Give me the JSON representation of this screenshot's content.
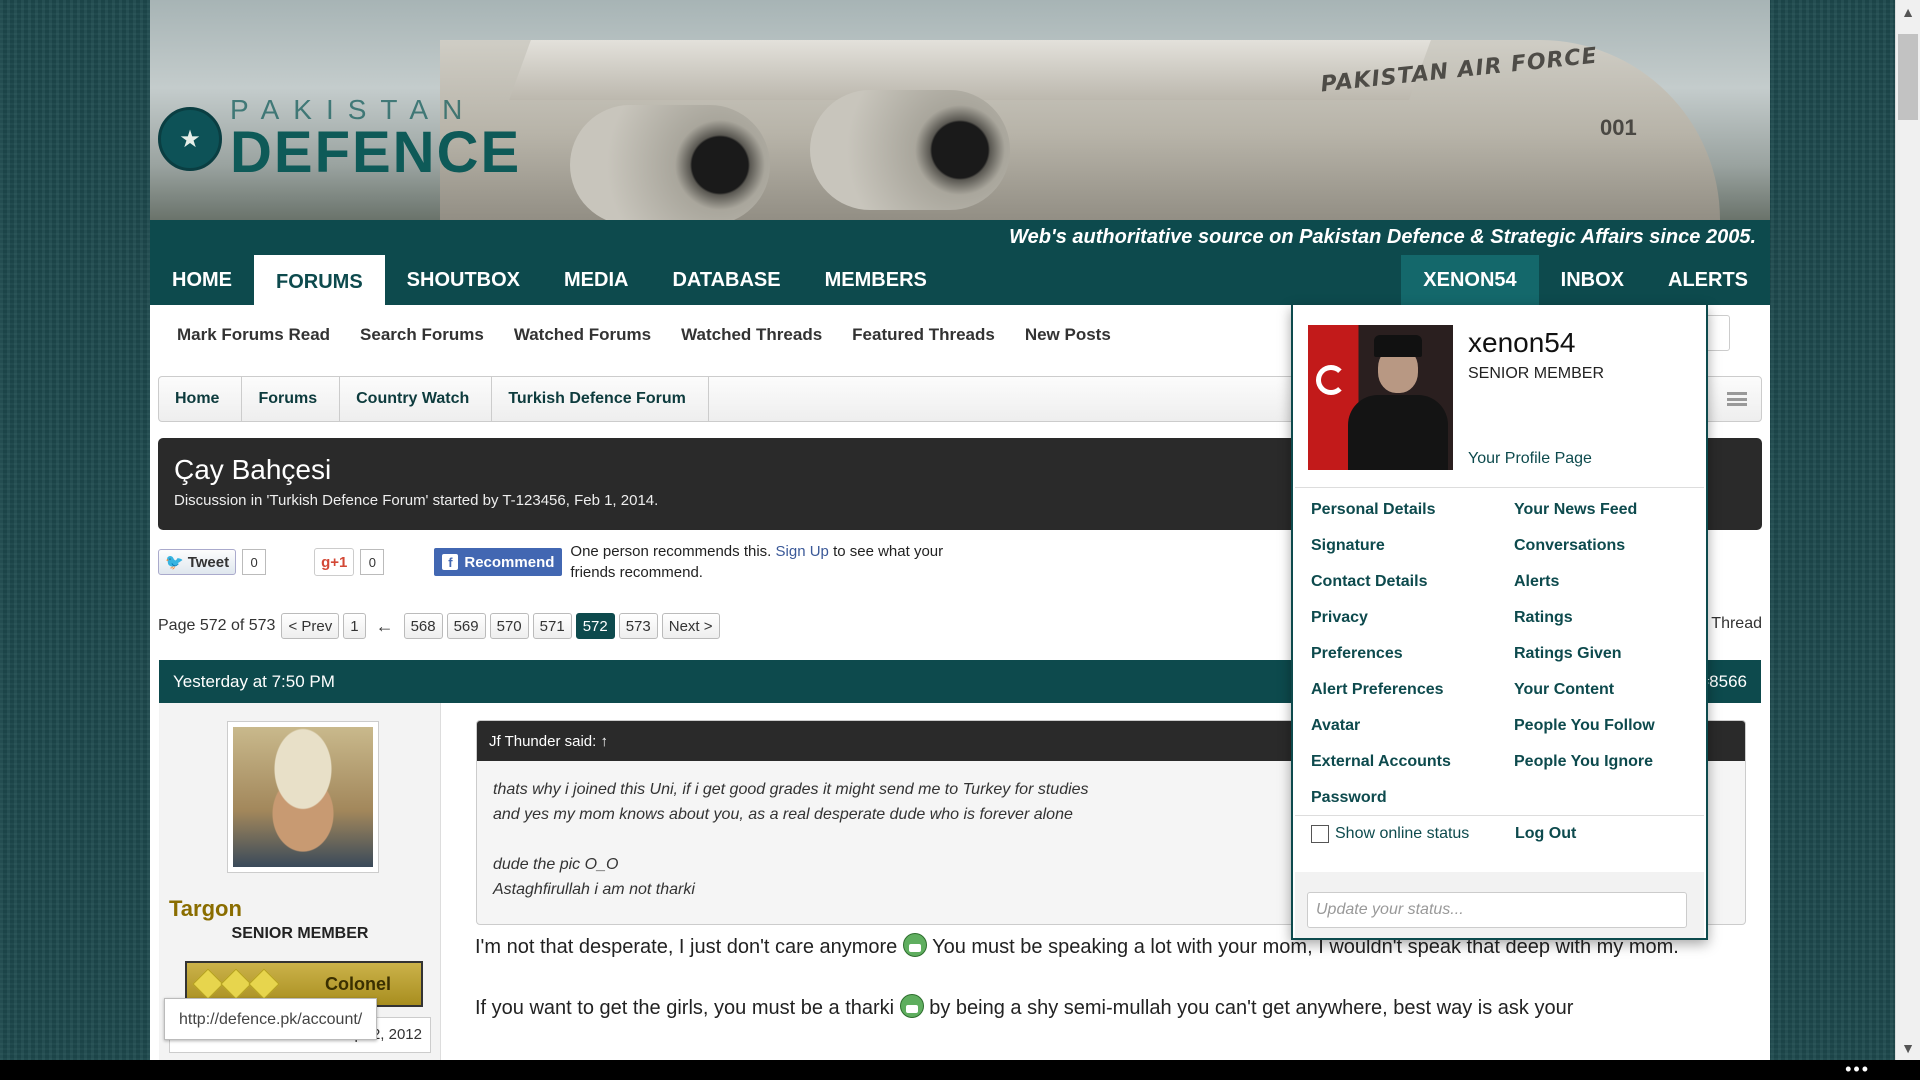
{
  "header": {
    "plane_text": "PAKISTAN AIR FORCE",
    "plane_number": "001",
    "logo_small": "PAKISTAN",
    "logo_big": "DEFENCE",
    "tagline": "Web's authoritative source on Pakistan Defence & Strategic Affairs since 2005."
  },
  "nav": {
    "items": [
      "HOME",
      "FORUMS",
      "SHOUTBOX",
      "MEDIA",
      "DATABASE",
      "MEMBERS"
    ],
    "right_items": [
      "XENON54",
      "INBOX",
      "ALERTS"
    ]
  },
  "subnav": {
    "items": [
      "Mark Forums Read",
      "Search Forums",
      "Watched Forums",
      "Watched Threads",
      "Featured Threads",
      "New Posts"
    ]
  },
  "breadcrumb": [
    "Home",
    "Forums",
    "Country Watch",
    "Turkish Defence Forum"
  ],
  "thread": {
    "title": "Çay Bahçesi",
    "description": "Discussion in 'Turkish Defence Forum' started by T-123456, Feb 1, 2014."
  },
  "share": {
    "tweet_label": "Tweet",
    "tweet_count": "0",
    "gplus_label": "+1",
    "gplus_count": "0",
    "fb_label": "Recommend",
    "fb_text_before": "One person recommends this.",
    "fb_link": "Sign Up",
    "fb_text_after": "to see what your friends recommend."
  },
  "pager": {
    "label": "Page 572 of 573",
    "prev": "< Prev",
    "first": "1",
    "arrow": "←",
    "pages": [
      "568",
      "569",
      "570",
      "571",
      "572",
      "573"
    ],
    "current": "572",
    "next": "Next >",
    "watch": "Watch Thread"
  },
  "post": {
    "time": "Yesterday at 7:50 PM",
    "number": "#8566",
    "author": "Targon",
    "author_title": "SENIOR MEMBER",
    "rank": "Colonel",
    "join_date": "Apr 2, 2012",
    "quote_author": "Jf Thunder said: ↑",
    "quote_lines": [
      "thats why i joined this Uni, if i get good grades it might send me to Turkey for studies",
      "and yes my mom knows about you, as a real desperate dude who is forever alone",
      "",
      "dude the pic O_O",
      "Astaghfirullah i am not tharki"
    ],
    "para1_a": "I'm not that desperate, I just don't care anymore",
    "para1_b": "You must be speaking a lot with your mom, I wouldn't speak that deep with my mom.",
    "para2_a": "If you want to get the girls, you must be a tharki",
    "para2_b": "by being a shy semi-mullah you can't get anywhere, best way is ask your"
  },
  "account_menu": {
    "username": "xenon54",
    "title": "SENIOR MEMBER",
    "profile_link": "Your Profile Page",
    "left_links": [
      "Personal Details",
      "Signature",
      "Contact Details",
      "Privacy",
      "Preferences",
      "Alert Preferences",
      "Avatar",
      "External Accounts",
      "Password"
    ],
    "right_links": [
      "Your News Feed",
      "Conversations",
      "Alerts",
      "Ratings",
      "Ratings Given",
      "Your Content",
      "People You Follow",
      "People You Ignore"
    ],
    "show_online_status": "Show online status",
    "logout": "Log Out",
    "status_placeholder": "Update your status..."
  },
  "statusbar_url": "http://defence.pk/account/"
}
